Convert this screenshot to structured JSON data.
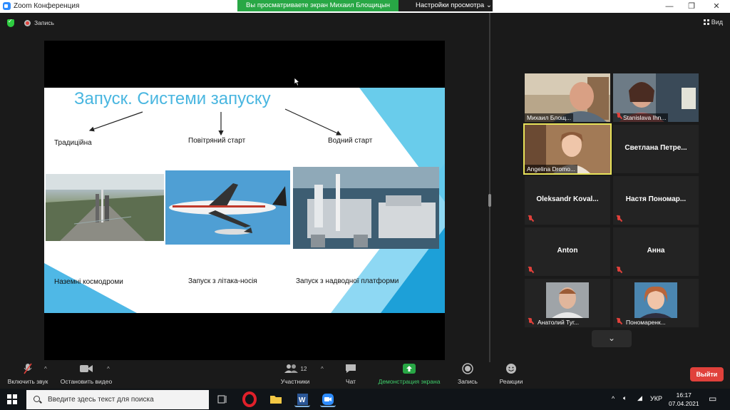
{
  "window": {
    "title": "Zoom Конференция",
    "share_banner": "Вы просматриваете экран Михаил Блощицын",
    "view_options": "Настройки просмотра"
  },
  "subbar": {
    "record_label": "Запись",
    "view_label": "Вид"
  },
  "slide": {
    "title": "Запуск. Системи запуску",
    "categories": [
      "Традиційна",
      "Повітряний старт",
      "Водний старт"
    ],
    "captions": [
      "Наземні космодроми",
      "Запуск з літака-носія",
      "Запуск з надводної платформи"
    ]
  },
  "participants": [
    {
      "name": "Михаил Блощ...",
      "video": true
    },
    {
      "name": "Stanislava Ihn...",
      "video": true,
      "muted": true
    },
    {
      "name": "Angelina Dromo...",
      "video": true,
      "active": true
    },
    {
      "name": "Светлана Петре...",
      "video": false
    },
    {
      "name": "Oleksandr Koval...",
      "video": false,
      "muted": true
    },
    {
      "name": "Настя Пономар...",
      "video": false,
      "muted": true
    },
    {
      "name": "Anton",
      "video": false,
      "muted": true
    },
    {
      "name": "Анна",
      "video": false,
      "muted": true
    },
    {
      "name": "Анатолий Туг...",
      "video": true,
      "muted": true
    },
    {
      "name": "Пономаренк...",
      "video": true,
      "muted": true
    }
  ],
  "toolbar": {
    "mute": "Включить звук",
    "video": "Остановить видео",
    "participants": "Участники",
    "participants_count": "12",
    "chat": "Чат",
    "share": "Демонстрация экрана",
    "record": "Запись",
    "reactions": "Реакции",
    "leave": "Выйти"
  },
  "taskbar": {
    "search_placeholder": "Введите здесь текст для поиска",
    "lang": "УКР",
    "time": "16:17",
    "date": "07.04.2021"
  },
  "colors": {
    "accent_green": "#28a745",
    "leave_red": "#e0413b",
    "active_speaker": "#e8e35a",
    "slide_title_blue": "#49b6e0"
  }
}
